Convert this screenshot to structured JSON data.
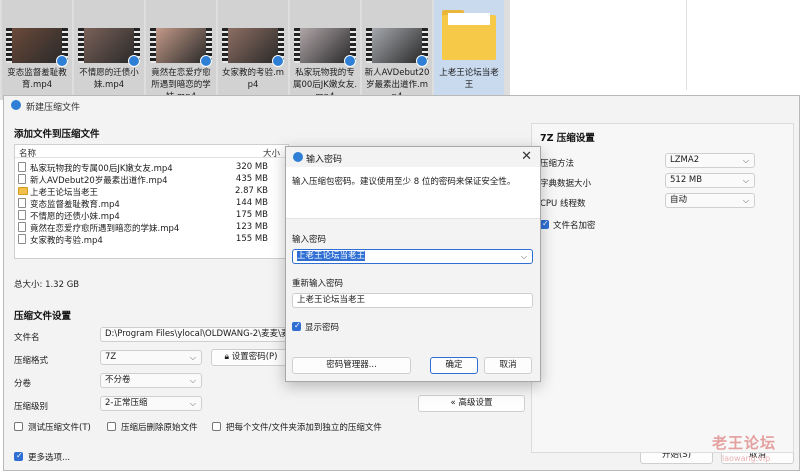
{
  "explorer": {
    "tiles": [
      {
        "name": "变态监督羞耻教育.mp4",
        "thumb_color": "#6b4a3a"
      },
      {
        "name": "不情愿的迁债小妹.mp4",
        "thumb_color": "#7a6158"
      },
      {
        "name": "竟然在恋爱疗愈所遇到暗恋的学妹.mp4",
        "thumb_color": "#c49a88"
      },
      {
        "name": "女家教的考验.mp4",
        "thumb_color": "#8d6e62"
      },
      {
        "name": "私家玩物我的专属00后JK嫩女友.mp4",
        "thumb_color": "#b0a6a8"
      },
      {
        "name": "新人AVDebut20岁最素出道作.mp4",
        "thumb_color": "#a5a8ad"
      }
    ],
    "folder": {
      "name": "上老王论坛当老王"
    }
  },
  "main_dialog": {
    "title": "新建压缩文件",
    "add_files_title": "添加文件到压缩文件",
    "columns": {
      "name": "名称",
      "size": "大小"
    },
    "files": [
      {
        "name": "私家玩物我的专属00后JK嫩女友.mp4",
        "size": "320 MB",
        "type": "file"
      },
      {
        "name": "新人AVDebut20岁最素出道作.mp4",
        "size": "435 MB",
        "type": "file"
      },
      {
        "name": "上老王论坛当老王",
        "size": "2.87 KB",
        "type": "folder"
      },
      {
        "name": "变态监督羞耻教育.mp4",
        "size": "144 MB",
        "type": "file"
      },
      {
        "name": "不情愿的还债小妹.mp4",
        "size": "175 MB",
        "type": "file"
      },
      {
        "name": "竟然在恋爱疗愈所遇到暗恋的学妹.mp4",
        "size": "123 MB",
        "type": "file"
      },
      {
        "name": "女家教的考验.mp4",
        "size": "155 MB",
        "type": "file"
      }
    ],
    "total_size": "总大小: 1.32 GB",
    "settings_title": "压缩文件设置",
    "filename_label": "文件名",
    "filename_value": "D:\\Program Files\\ylocal\\OLDWANG-2\\麦麦\\麦",
    "format_label": "压缩格式",
    "format_value": "7Z",
    "set_password_label": "设置密码(P)",
    "split_label": "分卷",
    "split_value": "不分卷",
    "level_label": "压缩级别",
    "level_value": "2-正常压缩",
    "advanced_label": "« 高级设置",
    "test_label": "测试压缩文件(T)",
    "delete_label": "压缩后删除原始文件",
    "separate_label": "把每个文件/文件夹添加到独立的压缩文件",
    "more_options_label": "更多选项...",
    "start_label": "开始(S)",
    "cancel_label": "取消",
    "right_panel": {
      "title": "7Z 压缩设置",
      "method_label": "压缩方法",
      "method_value": "LZMA2",
      "dict_label": "字典数据大小",
      "dict_value": "512 MB",
      "cpu_label": "CPU 线程数",
      "cpu_value": "自动",
      "encrypt_names_label": "文件名加密"
    }
  },
  "password_dialog": {
    "title": "输入密码",
    "close_glyph": "✕",
    "instruction": "输入压缩包密码。建议使用至少 8 位的密码来保证安全性。",
    "password_label": "输入密码",
    "password_value": "上老王论坛当老王",
    "confirm_label": "重新输入密码",
    "confirm_value": "上老王论坛当老王",
    "show_password_label": "显示密码",
    "manager_label": "密码管理器...",
    "ok_label": "确定",
    "cancel_label": "取消"
  },
  "watermark": {
    "main": "老王论坛",
    "sub": "laowang.vip"
  },
  "colors": {
    "accent": "#2f6fd4",
    "folder": "#f7c948"
  }
}
